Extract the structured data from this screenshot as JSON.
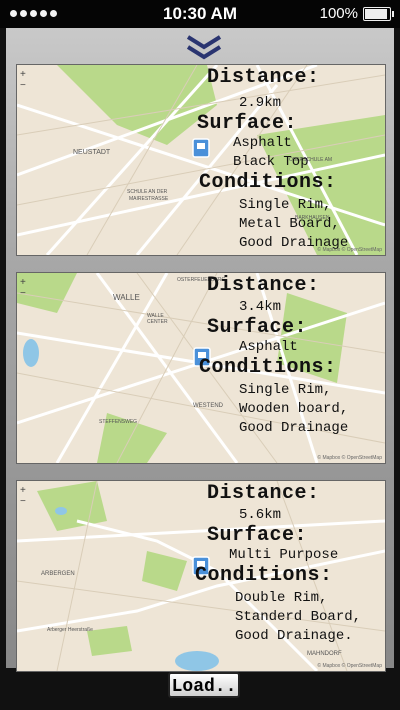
{
  "status_bar": {
    "time": "10:30 AM",
    "battery": "100%"
  },
  "cards": [
    {
      "distance_label": "Distance:",
      "distance": "2.9km",
      "surface_label": "Surface:",
      "surface": [
        "Asphalt",
        "Black Top"
      ],
      "conditions_label": "Conditions:",
      "conditions": [
        "Single Rim,",
        "Metal Board,",
        "Good Drainage"
      ],
      "map_labels": [
        "NEUSTADT",
        "SCHULE AN DER",
        "MAIRESTRASSE",
        "OBERSCHULE AM",
        "BARKHAUSEN"
      ]
    },
    {
      "distance_label": "Distance:",
      "distance": "3.4km",
      "surface_label": "Surface:",
      "surface": [
        "Asphalt"
      ],
      "conditions_label": "Conditions:",
      "conditions": [
        "Single Rim,",
        "Wooden board,",
        "Good Drainage"
      ],
      "map_labels": [
        "WALLE",
        "OSTERFEUERBERG",
        "WALLE",
        "CENTER",
        "WESTEND",
        "STEFFENSWEG"
      ]
    },
    {
      "distance_label": "Distance:",
      "distance": "5.6km",
      "surface_label": "Surface:",
      "surface": [
        "Multi Purpose"
      ],
      "conditions_label": "Conditions:",
      "conditions": [
        "Double Rim,",
        "Standerd Board,",
        "Good Drainage."
      ],
      "map_labels": [
        "ARBERGEN",
        "MAHNDORF",
        "Arberger Heerstraße"
      ]
    }
  ],
  "load_button": "Load..",
  "attribution": "© Mapbox © OpenStreetMap",
  "colors": {
    "park": "#b9d98a",
    "water": "#8fc6e6",
    "road": "#ffffff",
    "land": "#eee5d6"
  },
  "icons": {
    "chevron": "double-chevron-down-icon",
    "marker": "court-marker-icon"
  }
}
